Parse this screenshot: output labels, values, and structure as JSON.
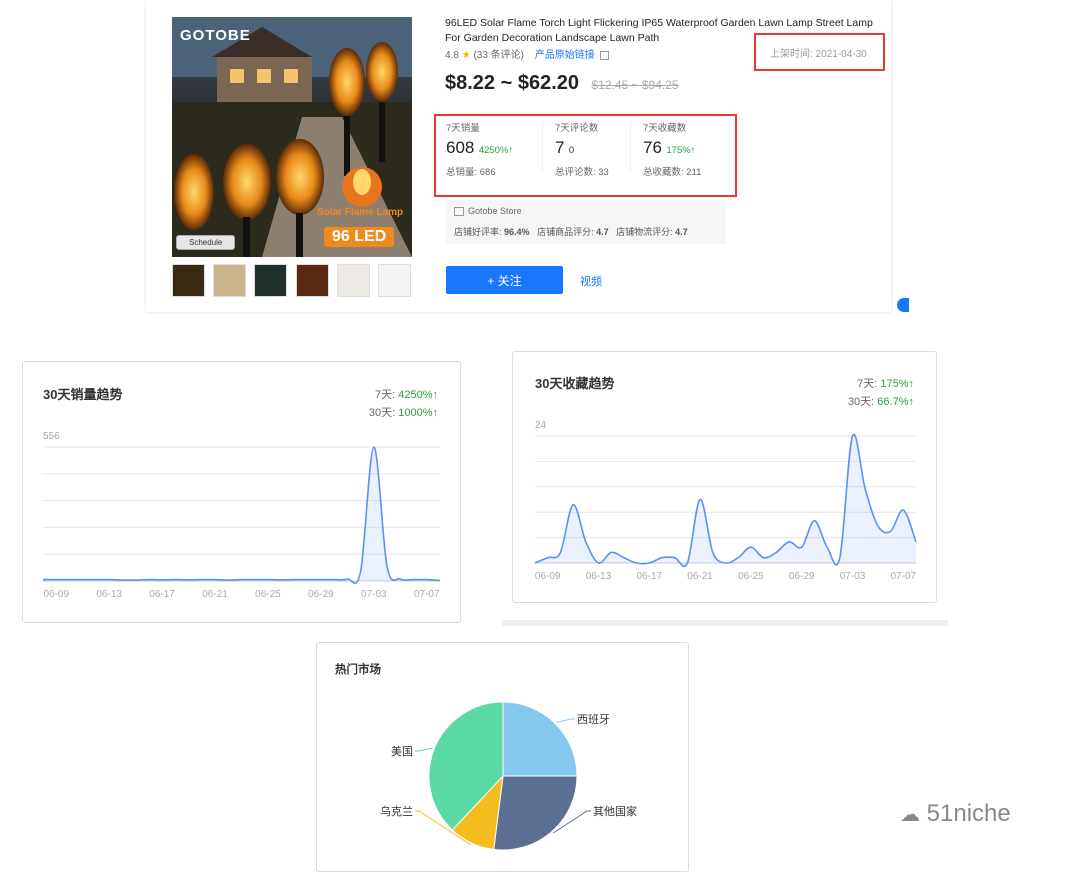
{
  "product": {
    "brand_logo": "GOTOBE",
    "image_caption": "Solar Flame Lamp",
    "image_badge": "96 LED",
    "schedule_tag": "Schedule",
    "title": "96LED Solar Flame Torch Light Flickering IP65 Waterproof Garden Lawn Lamp Street Lamp For Garden Decoration Landscape Lawn Path",
    "rating": "4.8",
    "review_count": "(33 条评论)",
    "original_link": "产品原始链接",
    "listed_date": "上架时间: 2021-04-30",
    "price_range": "$8.22 ~ $62.20",
    "original_price": "$12.45 ~ $94.25",
    "stats": [
      {
        "label": "7天销量",
        "value": "608",
        "change": "4250%↑",
        "total_label": "总销量: 686"
      },
      {
        "label": "7天评论数",
        "value": "7",
        "change": "0",
        "total_label": "总评论数: 33"
      },
      {
        "label": "7天收藏数",
        "value": "76",
        "change": "175%↑",
        "total_label": "总收藏数: 211"
      }
    ],
    "store": {
      "name": "Gotobe Store",
      "positive_label": "店铺好评率:",
      "positive_value": "96.4%",
      "item_label": "店铺商品评分:",
      "item_value": "4.7",
      "logistics_label": "店铺物流评分:",
      "logistics_value": "4.7"
    },
    "follow_button": "+ 关注",
    "video_link": "视频"
  },
  "sales_chart": {
    "title": "30天销量趋势",
    "delta7_label": "7天:",
    "delta7_value": "4250%↑",
    "delta30_label": "30天:",
    "delta30_value": "1000%↑"
  },
  "fav_chart": {
    "title": "30天收藏趋势",
    "delta7_label": "7天:",
    "delta7_value": "175%↑",
    "delta30_label": "30天:",
    "delta30_value": "66.7%↑"
  },
  "market_chart": {
    "title": "热门市场"
  },
  "watermark": "51niche",
  "colors": {
    "accent_blue": "#1677ff",
    "line_blue": "#5b8ff9",
    "positive_green": "#2e9e44",
    "highlight_red": "#e53b32"
  },
  "chart_data": [
    {
      "type": "area",
      "title": "30天销量趋势",
      "ylim": [
        0,
        556
      ],
      "y_tick_labels": [
        "556"
      ],
      "x_tick_labels": [
        "06-09",
        "06-13",
        "06-17",
        "06-21",
        "06-25",
        "06-29",
        "07-03",
        "07-07"
      ],
      "x": [
        "06-08",
        "06-09",
        "06-10",
        "06-11",
        "06-12",
        "06-13",
        "06-14",
        "06-15",
        "06-16",
        "06-17",
        "06-18",
        "06-19",
        "06-20",
        "06-21",
        "06-22",
        "06-23",
        "06-24",
        "06-25",
        "06-26",
        "06-27",
        "06-28",
        "06-29",
        "06-30",
        "07-01",
        "07-02",
        "07-03",
        "07-04",
        "07-05",
        "07-06",
        "07-07",
        "07-08"
      ],
      "values": [
        6,
        6,
        6,
        6,
        6,
        6,
        4,
        4,
        6,
        5,
        6,
        5,
        6,
        6,
        4,
        6,
        6,
        6,
        5,
        6,
        6,
        6,
        6,
        8,
        40,
        556,
        60,
        8,
        6,
        6,
        2
      ],
      "grid": true
    },
    {
      "type": "area",
      "title": "30天收藏趋势",
      "ylim": [
        0,
        24
      ],
      "y_tick_labels": [
        "24"
      ],
      "x_tick_labels": [
        "06-09",
        "06-13",
        "06-17",
        "06-21",
        "06-25",
        "06-29",
        "07-03",
        "07-07"
      ],
      "x": [
        "06-08",
        "06-09",
        "06-10",
        "06-11",
        "06-12",
        "06-13",
        "06-14",
        "06-15",
        "06-16",
        "06-17",
        "06-18",
        "06-19",
        "06-20",
        "06-21",
        "06-22",
        "06-23",
        "06-24",
        "06-25",
        "06-26",
        "06-27",
        "06-28",
        "06-29",
        "06-30",
        "07-01",
        "07-02",
        "07-03",
        "07-04",
        "07-05",
        "07-06",
        "07-07",
        "07-08"
      ],
      "values": [
        0,
        1,
        2,
        11,
        4,
        0,
        2,
        1,
        0,
        0,
        1,
        1,
        0,
        12,
        2,
        0,
        1,
        3,
        1,
        2,
        4,
        3,
        8,
        3,
        1,
        24,
        14,
        7,
        6,
        10,
        4
      ],
      "grid": true
    },
    {
      "type": "pie",
      "title": "热门市场",
      "categories": [
        "西班牙",
        "其他国家",
        "乌克兰",
        "美国"
      ],
      "values": [
        25,
        27,
        10,
        38
      ],
      "colors": [
        "#85c8ee",
        "#5c7093",
        "#f4bc1f",
        "#5ad8a6"
      ]
    }
  ]
}
